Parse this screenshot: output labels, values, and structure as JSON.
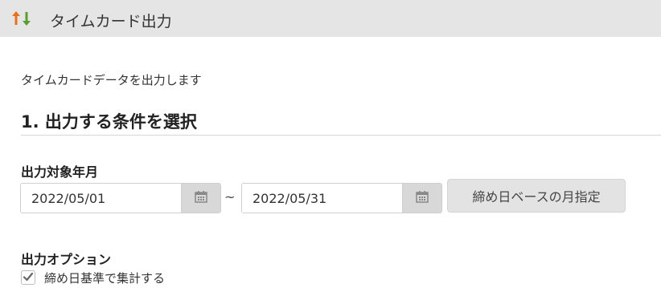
{
  "header": {
    "icon": "sort-arrows-icon",
    "title": "タイムカード出力"
  },
  "intro": "タイムカードデータを出力します",
  "section": {
    "title": "1. 出力する条件を選択"
  },
  "period": {
    "label": "出力対象年月",
    "from": "2022/05/01",
    "separator": "~",
    "to": "2022/05/31",
    "calendar_icon": "calendar-icon",
    "month_button_label": "締め日ベースの月指定"
  },
  "options": {
    "label": "出力オプション",
    "checkbox_label": "締め日基準で集計する",
    "checked": true
  },
  "colors": {
    "header_bg": "#e5e5e5",
    "arrow_up": "#e8711c",
    "arrow_down": "#5a9e2f",
    "button_bg": "#e3e3e3"
  }
}
